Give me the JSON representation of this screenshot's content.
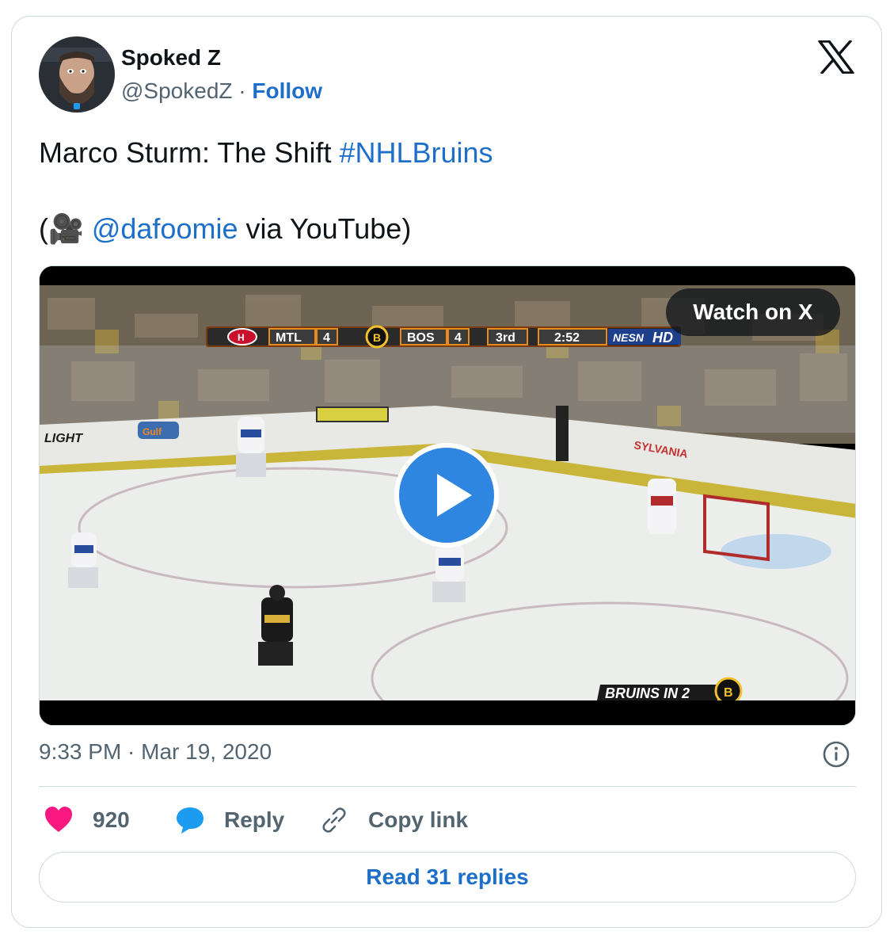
{
  "author": {
    "name": "Spoked Z",
    "handle": "@SpokedZ",
    "separator": "·",
    "follow_label": "Follow"
  },
  "tweet": {
    "text_prefix": "Marco Sturm: The Shift ",
    "hashtag": "#NHLBruins",
    "credit_open": "(",
    "camera_emoji": "🎥",
    "mention": "@dafoomie",
    "credit_suffix": " via YouTube)"
  },
  "media": {
    "watch_label": "Watch on X",
    "scoreboard": {
      "away_team": "MTL",
      "away_score": "4",
      "home_team": "BOS",
      "home_score": "4",
      "period": "3rd",
      "clock": "2:52",
      "network": "NESN",
      "network_suffix": "HD"
    },
    "lower_third": "BRUINS IN 2",
    "board_ads": [
      "LIGHT",
      "Gulf",
      "SYLVANIA"
    ]
  },
  "meta": {
    "timestamp": "9:33 PM · Mar 19, 2020"
  },
  "actions": {
    "like_count": "920",
    "reply_label": "Reply",
    "copy_label": "Copy link",
    "read_replies_label": "Read 31 replies"
  },
  "colors": {
    "link": "#1d6fc9",
    "like": "#f91880",
    "reply": "#1d9bf0",
    "secondary_text": "#536471",
    "play_button": "#2f86e0"
  }
}
